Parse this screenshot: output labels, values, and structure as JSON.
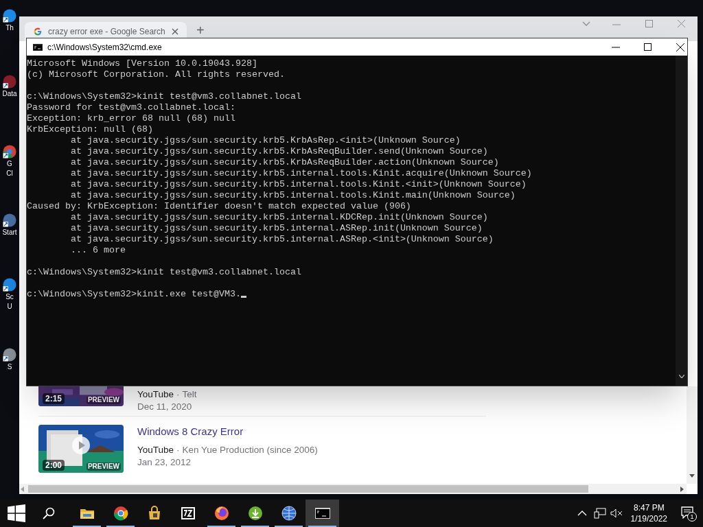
{
  "desktop_icons": [
    {
      "label": "Th",
      "kind": "blue"
    },
    {
      "label": "Data",
      "kind": "red"
    },
    {
      "label": "G\nCl",
      "kind": "chrome"
    },
    {
      "label": "Start",
      "kind": "globe"
    },
    {
      "label": "Sc\nU",
      "kind": "blue"
    },
    {
      "label": "S",
      "kind": "gray"
    }
  ],
  "browser": {
    "tab": {
      "title": "crazy error exe - Google Search",
      "selected": true
    },
    "new_tab": "+",
    "results": [
      {
        "source": "YouTube",
        "separator": "·",
        "author": "Telt",
        "date": "Dec 11, 2020",
        "duration": "2:15",
        "preview": "PREVIEW"
      },
      {
        "title": "Windows 8 Crazy Error",
        "source": "YouTube",
        "separator": "·",
        "author": "Ken Yue Production (since 2006)",
        "date": "Jan 23, 2012",
        "duration": "2:00",
        "preview": "PREVIEW",
        "play": true
      }
    ]
  },
  "console_window": {
    "title": "c:\\Windows\\System32\\cmd.exe",
    "output": "Microsoft Windows [Version 10.0.19043.928]\n(c) Microsoft Corporation. All rights reserved.\n\nc:\\Windows\\System32>kinit test@vm3.collabnet.local\nPassword for test@vm3.collabnet.local:\nException: krb_error 68 null (68) null\nKrbException: null (68)\n        at java.security.jgss/sun.security.krb5.KrbAsRep.<init>(Unknown Source)\n        at java.security.jgss/sun.security.krb5.KrbAsReqBuilder.send(Unknown Source)\n        at java.security.jgss/sun.security.krb5.KrbAsReqBuilder.action(Unknown Source)\n        at java.security.jgss/sun.security.krb5.internal.tools.Kinit.acquire(Unknown Source)\n        at java.security.jgss/sun.security.krb5.internal.tools.Kinit.<init>(Unknown Source)\n        at java.security.jgss/sun.security.krb5.internal.tools.Kinit.main(Unknown Source)\nCaused by: KrbException: Identifier doesn't match expected value (906)\n        at java.security.jgss/sun.security.krb5.internal.KDCRep.init(Unknown Source)\n        at java.security.jgss/sun.security.krb5.internal.ASRep.init(Unknown Source)\n        at java.security.jgss/sun.security.krb5.internal.ASRep.<init>(Unknown Source)\n        ... 6 more\n\nc:\\Windows\\System32>kinit test@vm3.collabnet.local",
    "input_line": "c:\\Windows\\System32>kinit.exe test@VM3."
  },
  "taskbar": {
    "apps": [
      {
        "kind": "folder",
        "running": true,
        "selected": false
      },
      {
        "kind": "chrome",
        "running": true,
        "selected": false
      },
      {
        "kind": "bag",
        "running": false,
        "selected": false
      },
      {
        "kind": "archive",
        "running": false,
        "selected": false
      },
      {
        "kind": "firefox",
        "running": true,
        "selected": false
      },
      {
        "kind": "download",
        "running": true,
        "selected": false
      },
      {
        "kind": "globe",
        "running": true,
        "selected": false
      },
      {
        "kind": "console",
        "running": true,
        "selected": true
      }
    ],
    "time": "8:47 PM",
    "date": "1/19/2022",
    "notifications": "1"
  }
}
